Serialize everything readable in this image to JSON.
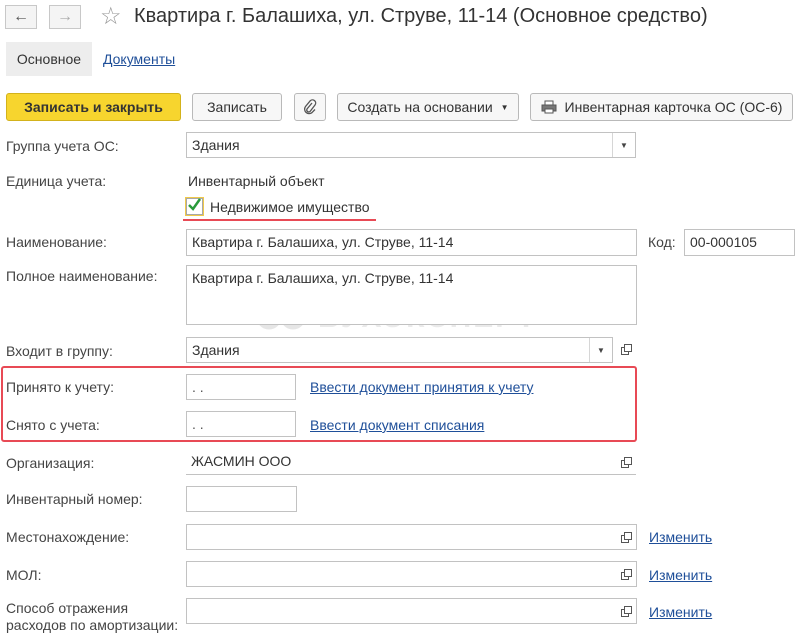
{
  "header": {
    "title": "Квартира г. Балашиха, ул. Струве, 11-14 (Основное средство)"
  },
  "tabs": {
    "main": "Основное",
    "documents": "Документы"
  },
  "toolbar": {
    "save_close": "Записать и закрыть",
    "save": "Записать",
    "create_based": "Создать на основании",
    "inventory_card": "Инвентарная карточка ОС (ОС-6)"
  },
  "form": {
    "group_label": "Группа учета ОС:",
    "group_value": "Здания",
    "unit_label": "Единица учета:",
    "unit_value": "Инвентарный объект",
    "real_estate_label": "Недвижимое имущество",
    "real_estate_checked": true,
    "name_label": "Наименование:",
    "name_value": "Квартира г. Балашиха, ул. Струве, 11-14",
    "code_label": "Код:",
    "code_value": "00-000105",
    "fullname_label": "Полное наименование:",
    "fullname_value": "Квартира г. Балашиха, ул. Струве, 11-14",
    "parent_label": "Входит в группу:",
    "parent_value": "Здания",
    "accepted_label": "Принято к учету:",
    "accepted_value": " .  .",
    "accepted_link": "Ввести документ принятия к учету",
    "removed_label": "Снято с учета:",
    "removed_value": " .  .",
    "removed_link": "Ввести документ списания",
    "org_label": "Организация:",
    "org_value": "ЖАСМИН ООО",
    "invnum_label": "Инвентарный номер:",
    "location_label": "Местонахождение:",
    "location_link": "Изменить",
    "mol_label": "МОЛ:",
    "mol_link": "Изменить",
    "amort_label_1": "Способ отражения",
    "amort_label_2": "расходов по амортизации:",
    "amort_link": "Изменить"
  },
  "watermark": "БУХЭКСПЕРТ",
  "colors": {
    "primary_button": "#f7d52e",
    "link": "#1f4f99",
    "highlight": "#e84a55"
  }
}
